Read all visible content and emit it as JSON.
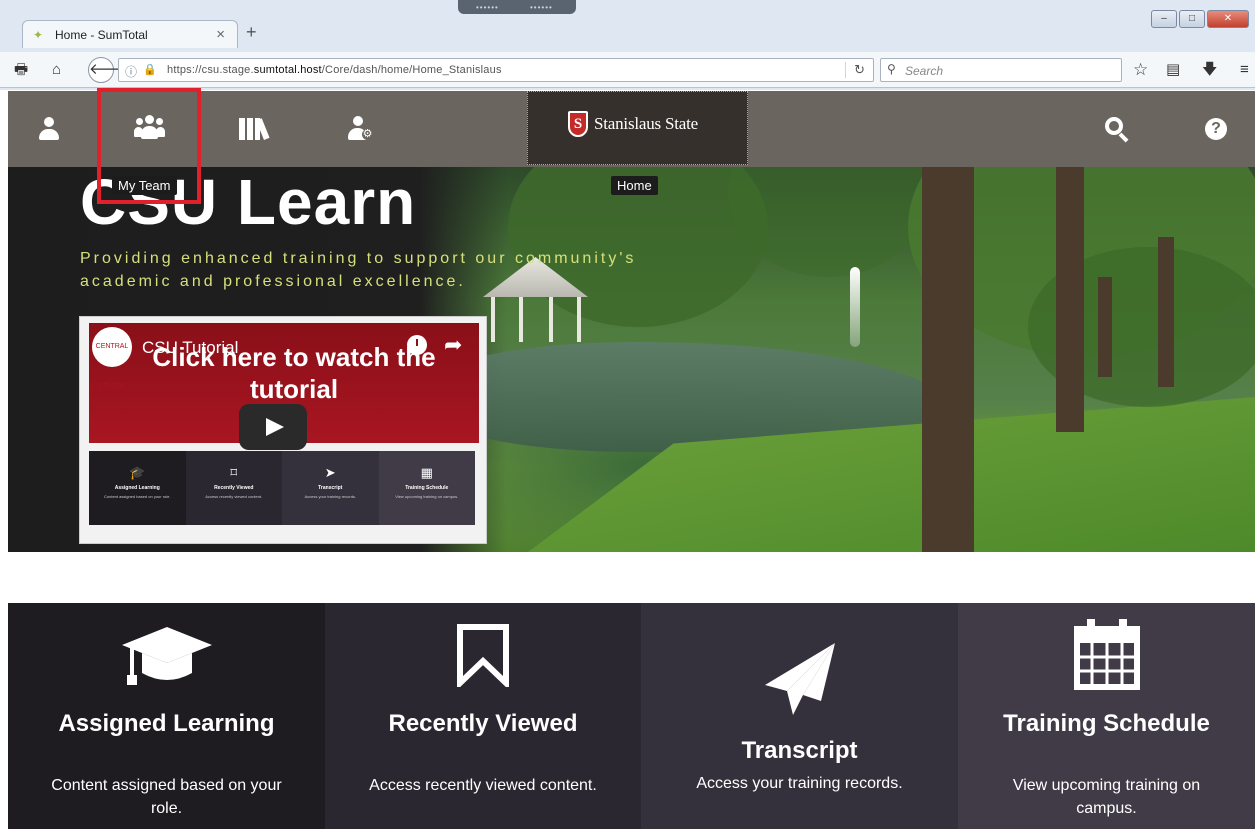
{
  "browser": {
    "tab_title": "Home - SumTotal",
    "tab_close": "×",
    "new_tab": "+",
    "url_prefix": "https://csu.stage.",
    "url_domain": "sumtotal.host",
    "url_path": "/Core/dash/home/Home_Stanislaus",
    "search_placeholder": "Search",
    "window_buttons": [
      "–",
      "□",
      "✕"
    ]
  },
  "header": {
    "logo_mark": "S",
    "logo_text": "Stanislaus State",
    "help_glyph": "?",
    "tooltips": {
      "my_team": "My Team",
      "home": "Home"
    }
  },
  "hero": {
    "title": "CSU Learn",
    "subtitle": "Providing enhanced training to support our community's academic and professional excellence."
  },
  "video": {
    "channel_logo_text": "CENTRAL STUDIO",
    "channel_title": "CSU Tutorial",
    "headline": "Click here to watch the tutorial",
    "mini_tiles": [
      {
        "title": "Assigned Learning",
        "desc": "Content assigned based on your role."
      },
      {
        "title": "Recently Viewed",
        "desc": "Access recently viewed content."
      },
      {
        "title": "Transcript",
        "desc": "Access your training records."
      },
      {
        "title": "Training Schedule",
        "desc": "View upcoming training on campus."
      }
    ]
  },
  "tiles": [
    {
      "title": "Assigned Learning",
      "desc": "Content assigned based on your role.",
      "icon": "graduation-cap-icon",
      "color": "#1e1c21"
    },
    {
      "title": "Recently Viewed",
      "desc": "Access recently viewed content.",
      "icon": "bookmark-icon",
      "color": "#2a2730"
    },
    {
      "title": "Transcript",
      "desc": "Access your training records.",
      "icon": "paper-plane-icon",
      "color": "#35313c"
    },
    {
      "title": "Training Schedule",
      "desc": "View upcoming training on campus.",
      "icon": "calendar-icon",
      "color": "#413b48"
    }
  ],
  "colors": {
    "header_bg": "#6b6560",
    "logo_bg": "#36302c",
    "highlight": "#e0202a",
    "subtitle": "#d6e07a"
  }
}
